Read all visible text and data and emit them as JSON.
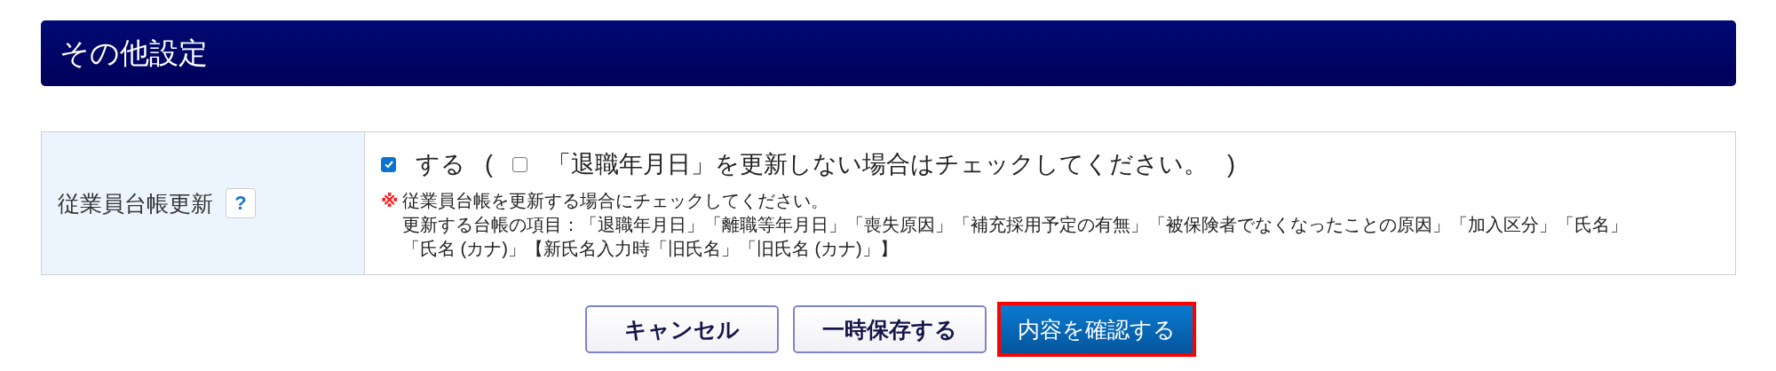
{
  "section": {
    "title": "その他設定"
  },
  "form_rows": [
    {
      "label": "従業員台帳更新",
      "help": "?",
      "checkbox": {
        "checked": true,
        "label": "する"
      },
      "paren_open": "(",
      "sub_checkbox": {
        "checked": false,
        "label": "「退職年月日」を更新しない場合はチェックしてください。"
      },
      "paren_close": ")",
      "note_mark": "※",
      "notes": [
        "従業員台帳を更新する場合にチェックしてください。",
        "更新する台帳の項目：「退職年月日」「離職等年月日」「喪失原因」「補充採用予定の有無」「被保険者でなくなったことの原因」「加入区分」「氏名」",
        "「氏名 (カナ)」【新氏名入力時「旧氏名」「旧氏名 (カナ)」】"
      ]
    }
  ],
  "buttons": [
    {
      "label": "キャンセル",
      "kind": "secondary",
      "highlighted": false
    },
    {
      "label": "一時保存する",
      "kind": "secondary",
      "highlighted": false
    },
    {
      "label": "内容を確認する",
      "kind": "primary",
      "highlighted": true
    }
  ]
}
